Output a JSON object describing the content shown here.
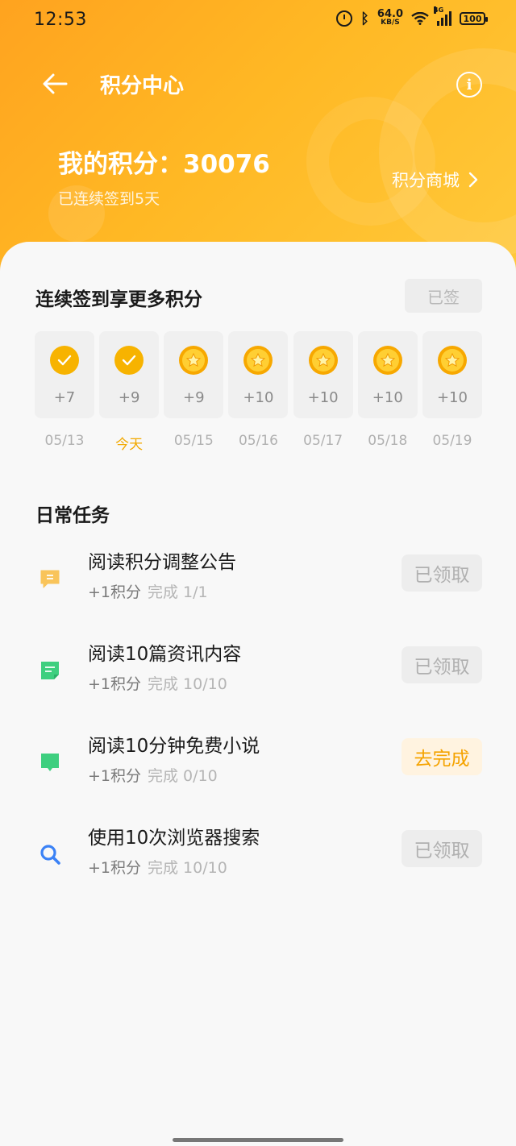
{
  "status_bar": {
    "time": "12:53",
    "net_speed_value": "64.0",
    "net_speed_unit": "KB/S",
    "signal_label": "4G",
    "battery": "100"
  },
  "header": {
    "title": "积分中心",
    "points_label": "我的积分：30076",
    "streak_text": "已连续签到5天",
    "mall_link": "积分商城"
  },
  "sign_in": {
    "title": "连续签到享更多积分",
    "button_label": "已签",
    "days": [
      {
        "points": "+7",
        "date": "05/13",
        "state": "checked"
      },
      {
        "points": "+9",
        "date": "今天",
        "state": "checked"
      },
      {
        "points": "+9",
        "date": "05/15",
        "state": "star"
      },
      {
        "points": "+10",
        "date": "05/16",
        "state": "star"
      },
      {
        "points": "+10",
        "date": "05/17",
        "state": "star"
      },
      {
        "points": "+10",
        "date": "05/18",
        "state": "star"
      },
      {
        "points": "+10",
        "date": "05/19",
        "state": "star"
      }
    ]
  },
  "daily_tasks": {
    "title": "日常任务",
    "items": [
      {
        "name": "阅读积分调整公告",
        "points": "+1积分",
        "progress": "完成 1/1",
        "button": "已领取",
        "icon": "notice-icon",
        "icon_color": "#f9c45a"
      },
      {
        "name": "阅读10篇资讯内容",
        "points": "+1积分",
        "progress": "完成 10/10",
        "button": "已领取",
        "icon": "news-icon",
        "icon_color": "#3ecf7f"
      },
      {
        "name": "阅读10分钟免费小说",
        "points": "+1积分",
        "progress": "完成 0/10",
        "button": "去完成",
        "icon": "book-icon",
        "icon_color": "#3ecf7f"
      },
      {
        "name": "使用10次浏览器搜索",
        "points": "+1积分",
        "progress": "完成 10/10",
        "button": "已领取",
        "icon": "search-icon",
        "icon_color": "#3b82f6"
      }
    ]
  },
  "colors": {
    "header_start": "#ffa31f",
    "header_end": "#ffc93a",
    "accent": "#f5a300"
  }
}
